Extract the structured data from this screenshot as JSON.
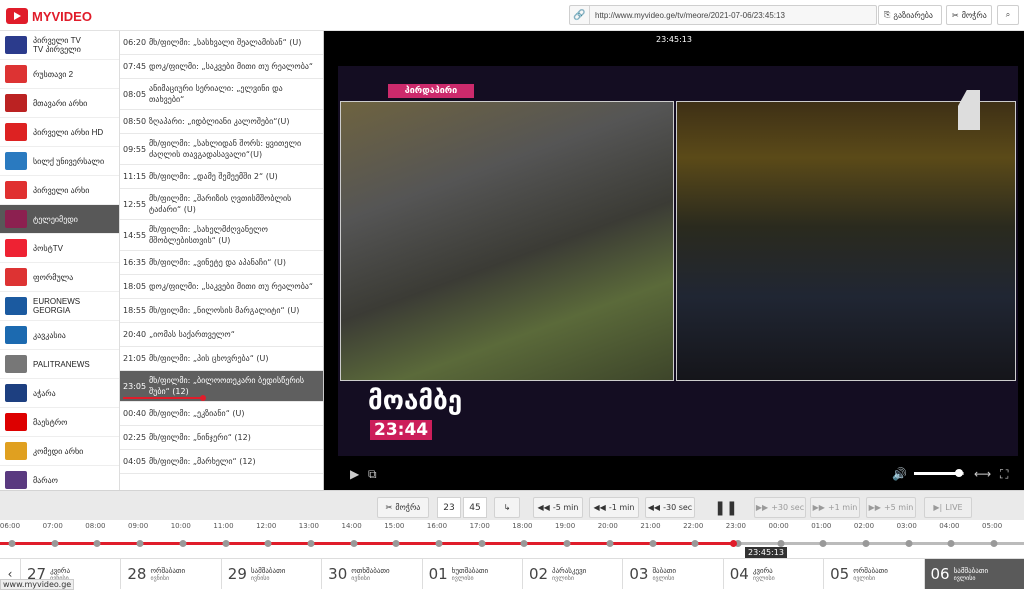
{
  "brand": {
    "name": "MYVIDEO",
    "color": "#e01c2a"
  },
  "header": {
    "url": "http://www.myvideo.ge/tv/meore/2021-07-06/23:45:13",
    "share_label": "გაზიარება",
    "cut_label": "მოჭრა",
    "link_icon": "link-icon",
    "search_icon": "search-icon"
  },
  "channels": [
    {
      "name": "პირველი TV\nTV პირველი",
      "color": "#2b3b8c"
    },
    {
      "name": "რუსთავი 2",
      "color": "#d33"
    },
    {
      "name": "მთავარი არხი",
      "color": "#b22"
    },
    {
      "name": "პირველი არხი HD",
      "color": "#d22"
    },
    {
      "name": "სილქ უნივერსალი",
      "color": "#2a7ac0"
    },
    {
      "name": "პირველი არხი",
      "color": "#e03030"
    },
    {
      "name": "ტელეიმედი",
      "color": "#8c2050",
      "active": true
    },
    {
      "name": "პოსტTV",
      "color": "#e23"
    },
    {
      "name": "ფორმულა",
      "color": "#d33"
    },
    {
      "name": "EURONEWS GEORGIA",
      "color": "#1b5aa0"
    },
    {
      "name": "კავკასია",
      "color": "#1c6ab0"
    },
    {
      "name": "PALITRANEWS",
      "color": "#777"
    },
    {
      "name": "აჭარა",
      "color": "#1d3f80"
    },
    {
      "name": "მაესტრო",
      "color": "#d00"
    },
    {
      "name": "კომედი არხი",
      "color": "#e0a020"
    },
    {
      "name": "მარაო",
      "color": "#5a3a80"
    }
  ],
  "schedule": [
    {
      "time": "06:20",
      "title": "მხ/ფილმი: „სასხვალი შეალამისან“ (U)"
    },
    {
      "time": "07:45",
      "title": "დოკ/ფილმი: „საკვები მითი თუ რეალობა“"
    },
    {
      "time": "08:05",
      "title": "ანიმაციური სერიალი: „ელვინი და თახვები“"
    },
    {
      "time": "08:50",
      "title": "ზღაპარი: „იდბლიანი კალოშები“(U)"
    },
    {
      "time": "09:55",
      "title": "მხ/ფილმი: „სახლიდან შორს: ყვითელი ძაღლის თავგადასავალი“(U)"
    },
    {
      "time": "11:15",
      "title": "მხ/ფილმი: „დამე შემეემში 2“ (U)"
    },
    {
      "time": "12:55",
      "title": "მხ/ფილმი: „შარიზის ღვთისმშობლის ტაძარი“ (U)"
    },
    {
      "time": "14:55",
      "title": "მხ/ფილმი: „სახელმძღვანელო მშობლებისთვის“ (U)"
    },
    {
      "time": "16:35",
      "title": "მხ/ფილმი: „ვინეტე და აპანაჩი“ (U)"
    },
    {
      "time": "18:05",
      "title": "დოკ/ფილმი: „საკვები მითი თუ რეალობა“"
    },
    {
      "time": "18:55",
      "title": "მხ/ფილმი: „ნილოსის მარგალიტი“ (U)"
    },
    {
      "time": "20:40",
      "title": "„იომას საქართველო“"
    },
    {
      "time": "21:05",
      "title": "მხ/ფილმი: „პის ცხოვრება“ (U)"
    },
    {
      "time": "23:05",
      "title": "მხ/ფილმი: „ბილოოთეკარი ბედისწერის შუბი“ (12)",
      "active": true,
      "progress": 0.4
    },
    {
      "time": "00:40",
      "title": "მხ/ფილმი: „ეკზიანი“ (U)"
    },
    {
      "time": "02:25",
      "title": "მხ/ფილმი: „ნინჯერი“ (12)"
    },
    {
      "time": "04:05",
      "title": "მხ/ფილმი: „მარხელი“ (12)"
    }
  ],
  "player": {
    "timestamp": "23:45:13",
    "tag": "პირდაპირი",
    "lower_third": "მოამბე",
    "lower_time": "23:44",
    "volume": 0.9
  },
  "controls": {
    "cut_label": "მოჭრა",
    "hour": "23",
    "minute": "45",
    "go_icon": "↳",
    "minus5": "-5 min",
    "minus1": "-1 min",
    "minus30": "-30 sec",
    "plus30": "+30 sec",
    "plus1": "+1 min",
    "plus5": "+5 min",
    "live": "LIVE"
  },
  "timeline": {
    "ticks": [
      "06:00",
      "07:00",
      "08:00",
      "09:00",
      "10:00",
      "11:00",
      "12:00",
      "13:00",
      "14:00",
      "15:00",
      "16:00",
      "17:00",
      "18:00",
      "19:00",
      "20:00",
      "21:00",
      "22:00",
      "23:00",
      "00:00",
      "01:00",
      "02:00",
      "03:00",
      "04:00",
      "05:00"
    ],
    "current": "23:45:13"
  },
  "days": [
    {
      "num": "27",
      "wd": "კვირა",
      "mon": "ივნისი"
    },
    {
      "num": "28",
      "wd": "ორშაბათი",
      "mon": "ივნისი"
    },
    {
      "num": "29",
      "wd": "სამშაბათი",
      "mon": "ივნისი"
    },
    {
      "num": "30",
      "wd": "ოთხშაბათი",
      "mon": "ივნისი"
    },
    {
      "num": "01",
      "wd": "ხუთშაბათი",
      "mon": "ივლისი"
    },
    {
      "num": "02",
      "wd": "პარასკევი",
      "mon": "ივლისი"
    },
    {
      "num": "03",
      "wd": "შაბათი",
      "mon": "ივლისი"
    },
    {
      "num": "04",
      "wd": "კვირა",
      "mon": "ივლისი"
    },
    {
      "num": "05",
      "wd": "ორშაბათი",
      "mon": "ივლისი"
    },
    {
      "num": "06",
      "wd": "სამშაბათი",
      "mon": "ივლისი",
      "active": true
    }
  ],
  "status": "www.myvideo.ge"
}
